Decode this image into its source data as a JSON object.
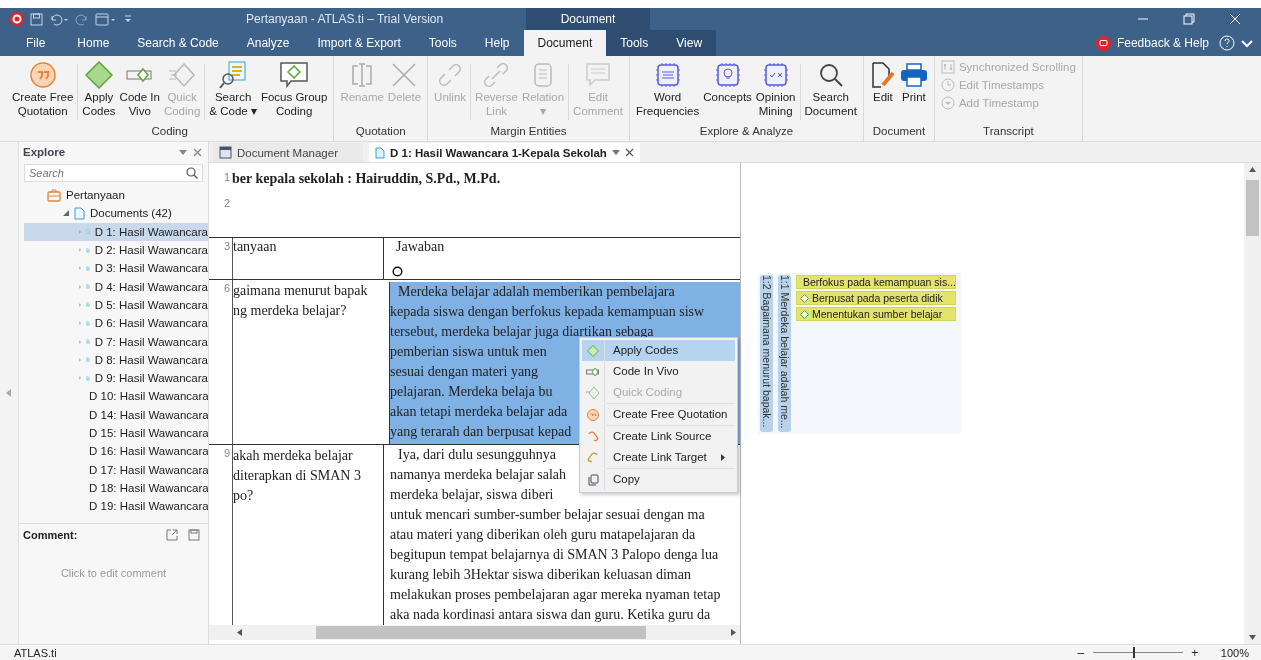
{
  "window": {
    "title": "Pertanyaan - ATLAS.ti – Trial Version",
    "context_tab_group": "Document"
  },
  "menu_tabs": [
    {
      "label": "File",
      "selected": false
    },
    {
      "label": "Home",
      "selected": false
    },
    {
      "label": "Search & Code",
      "selected": false
    },
    {
      "label": "Analyze",
      "selected": false
    },
    {
      "label": "Import & Export",
      "selected": false
    },
    {
      "label": "Tools",
      "selected": false
    },
    {
      "label": "Help",
      "selected": false
    },
    {
      "label": "Document",
      "selected": true
    },
    {
      "label": "Tools",
      "selected": false
    },
    {
      "label": "View",
      "selected": false
    }
  ],
  "feedback": "Feedback & Help",
  "ribbon": [
    {
      "label": "Coding",
      "items": [
        {
          "kind": "button",
          "label": "Create Free\nQuotation",
          "disabled": false
        },
        {
          "kind": "separator"
        },
        {
          "kind": "button",
          "label": "Apply\nCodes",
          "disabled": false
        },
        {
          "kind": "button",
          "label": "Code In\nVivo",
          "disabled": false
        },
        {
          "kind": "button",
          "label": "Quick\nCoding",
          "disabled": true
        },
        {
          "kind": "separator"
        },
        {
          "kind": "button",
          "label": "Search\n& Code ▾",
          "disabled": false
        },
        {
          "kind": "button",
          "label": "Focus Group\nCoding",
          "disabled": false
        }
      ]
    },
    {
      "label": "Quotation",
      "items": [
        {
          "kind": "button",
          "label": "Rename",
          "disabled": true
        },
        {
          "kind": "button",
          "label": "Delete",
          "disabled": true
        }
      ]
    },
    {
      "label": "Margin Entities",
      "items": [
        {
          "kind": "button",
          "label": "Unlink",
          "disabled": true
        },
        {
          "kind": "separator"
        },
        {
          "kind": "button",
          "label": "Reverse\nLink",
          "disabled": true
        },
        {
          "kind": "button",
          "label": "Relation\n▾",
          "disabled": true
        },
        {
          "kind": "separator"
        },
        {
          "kind": "button",
          "label": "Edit\nComment",
          "disabled": true
        }
      ]
    },
    {
      "label": "Explore & Analyze",
      "items": [
        {
          "kind": "button",
          "label": "Word\nFrequencies",
          "disabled": false
        },
        {
          "kind": "button",
          "label": "Concepts",
          "disabled": false
        },
        {
          "kind": "button",
          "label": "Opinion\nMining",
          "disabled": false
        },
        {
          "kind": "separator"
        },
        {
          "kind": "button",
          "label": "Search\nDocument",
          "disabled": false
        }
      ]
    },
    {
      "label": "Document",
      "items": [
        {
          "kind": "button",
          "label": "Edit",
          "disabled": false
        },
        {
          "kind": "button",
          "label": "Print",
          "disabled": false
        }
      ]
    },
    {
      "label": "Transcript",
      "items": [
        {
          "kind": "small",
          "label": "Synchronized Scrolling",
          "disabled": true
        },
        {
          "kind": "small",
          "label": "Edit Timestamps",
          "disabled": true
        },
        {
          "kind": "small",
          "label": "Add Timestamp",
          "disabled": true
        }
      ]
    }
  ],
  "explore": {
    "title": "Explore",
    "search": {
      "placeholder": "Search"
    },
    "tree": [
      {
        "label": "Pertanyaan",
        "children": [
          {
            "label": "Documents (42)",
            "expanded": true,
            "children": [
              {
                "label": "D 1: Hasil Wawancara",
                "selected": true
              },
              {
                "label": "D 2: Hasil Wawancara",
                "selected": false
              },
              {
                "label": "D 3: Hasil Wawancara",
                "selected": false
              },
              {
                "label": "D 4: Hasil Wawancara",
                "selected": false
              },
              {
                "label": "D 5: Hasil Wawancara",
                "selected": false
              },
              {
                "label": "D 6: Hasil Wawancara",
                "selected": false
              },
              {
                "label": "D 7: Hasil Wawancara",
                "selected": false
              },
              {
                "label": "D 8: Hasil Wawancara",
                "selected": false
              },
              {
                "label": "D 9: Hasil Wawancara",
                "selected": false
              },
              {
                "label": "D 10: Hasil Wawancara",
                "selected": false
              },
              {
                "label": "D 14: Hasil Wawancara",
                "selected": false
              },
              {
                "label": "D 15: Hasil Wawancara",
                "selected": false
              },
              {
                "label": "D 16: Hasil Wawancara",
                "selected": false
              },
              {
                "label": "D 17: Hasil Wawancara",
                "selected": false
              },
              {
                "label": "D 18: Hasil Wawancara",
                "selected": false
              },
              {
                "label": "D 19: Hasil Wawancara",
                "selected": false
              }
            ]
          }
        ]
      }
    ],
    "comment": {
      "title": "Comment:",
      "placeholder": "Click to edit comment"
    }
  },
  "doc_tabs": [
    {
      "label": "Document Manager",
      "selected": false
    },
    {
      "label": "D 1: Hasil Wawancara 1-Kepala Sekolah",
      "selected": true
    }
  ],
  "document": {
    "heading": {
      "line": "1",
      "text": "ber kepala sekolah : Hairuddin, S.Pd., M.Pd."
    },
    "blank_line": "2",
    "table": {
      "header": {
        "line": "3",
        "question": "tanyaan",
        "answer": "Jawaban"
      },
      "rows": [
        {
          "line": "6",
          "question": [
            "gaimana menurut bapak",
            "ng merdeka belajar?"
          ],
          "answer_selected": true,
          "answer": [
            "Merdeka belajar adalah memberikan pembelajara",
            "kepada siswa dengan berfokus kepada kemampuan sisw",
            "tersebut, merdeka belajar juga diartikan sebaga",
            "pemberian siswa untuk men",
            "sesuai dengan materi yang",
            "pelajaran. Merdeka belaja bu",
            "akan tetapi merdeka belajar ada",
            "yang terarah dan berpusat kepad"
          ]
        },
        {
          "line": "9",
          "question": [
            "akah merdeka belajar",
            "diterapkan di SMAN 3",
            "po?"
          ],
          "answer_selected": false,
          "answer": [
            "Iya, dari dulu sesungguhnya",
            "namanya merdeka belajar salah",
            "merdeka belajar, siswa diberi",
            "untuk mencari sumber-sumber belajar sesuai dengan ma",
            "atau materi yang diberikan oleh guru matapelajaran da",
            "begitupun tempat belajarnya di SMAN 3 Palopo denga lua",
            "kurang lebih 3Hektar siswa diberikan keluasan diman",
            "melakukan proses pembelajaran agar mereka nyaman tetap",
            "aka nada kordinasi antara siswa dan guru. Ketika guru da"
          ]
        }
      ]
    }
  },
  "context_menu": [
    {
      "label": "Apply Codes",
      "selected": true,
      "disabled": false,
      "submenu": false
    },
    {
      "label": "Code In Vivo",
      "selected": false,
      "disabled": false,
      "submenu": false
    },
    {
      "label": "Quick Coding",
      "selected": false,
      "disabled": true,
      "submenu": false
    },
    {
      "label": "Create Free Quotation",
      "selected": false,
      "disabled": false,
      "submenu": false
    },
    {
      "label": "Create Link Source",
      "selected": false,
      "disabled": false,
      "submenu": false
    },
    {
      "label": "Create Link Target",
      "selected": false,
      "disabled": false,
      "submenu": true
    },
    {
      "label": "Copy",
      "selected": false,
      "disabled": false,
      "submenu": false
    }
  ],
  "margin": {
    "quotations": [
      "1:2 Bagaimana menurut bapak...",
      "1:1 Merdeka belajar adalah me..."
    ],
    "codes": [
      "Berfokus pada kemampuan sis...",
      "Berpusat pada peserta didik",
      "Menentukan sumber belajar"
    ]
  },
  "status_bar": {
    "text": "ATLAS.ti",
    "zoom": {
      "minus": "–",
      "plus": "+",
      "level": 0.45,
      "reading": "100%"
    }
  }
}
